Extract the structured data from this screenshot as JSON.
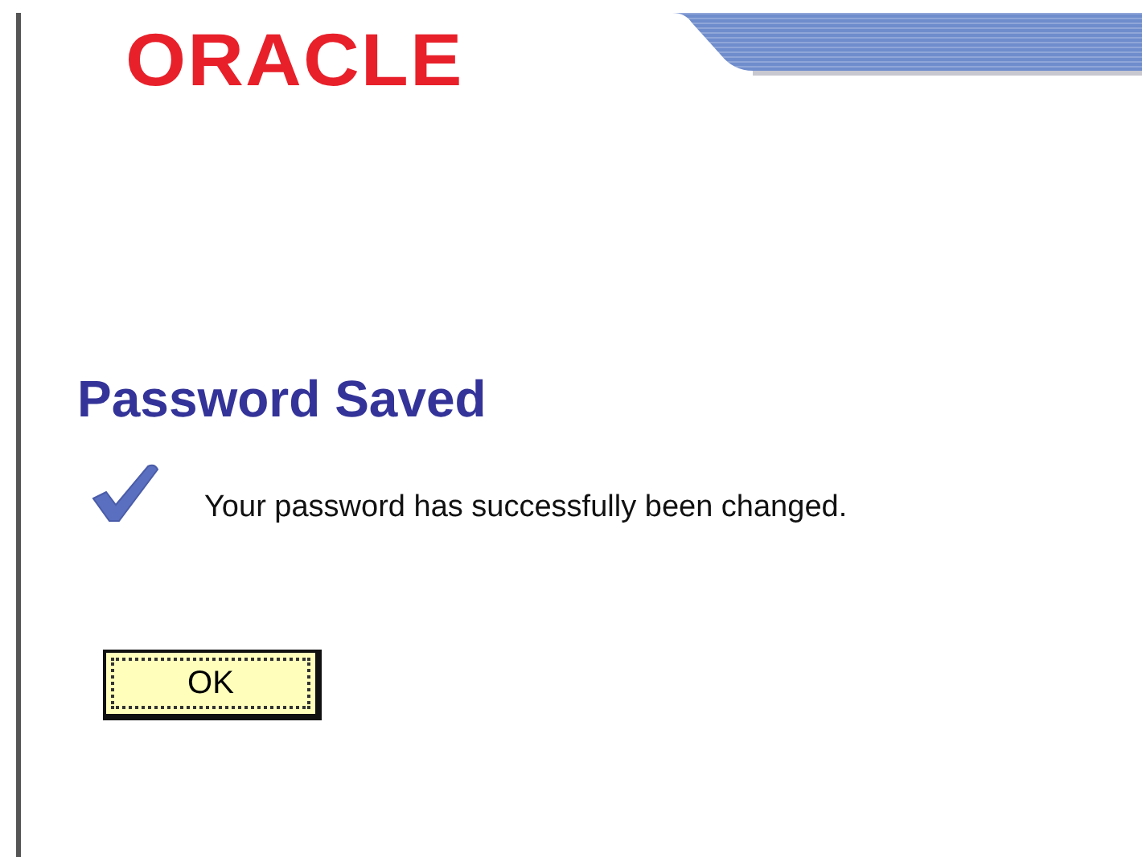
{
  "logo": {
    "text": "ORACLE"
  },
  "heading": "Password Saved",
  "message": "Your password has successfully been changed.",
  "buttons": [
    {
      "label": "OK",
      "focused": true
    }
  ]
}
